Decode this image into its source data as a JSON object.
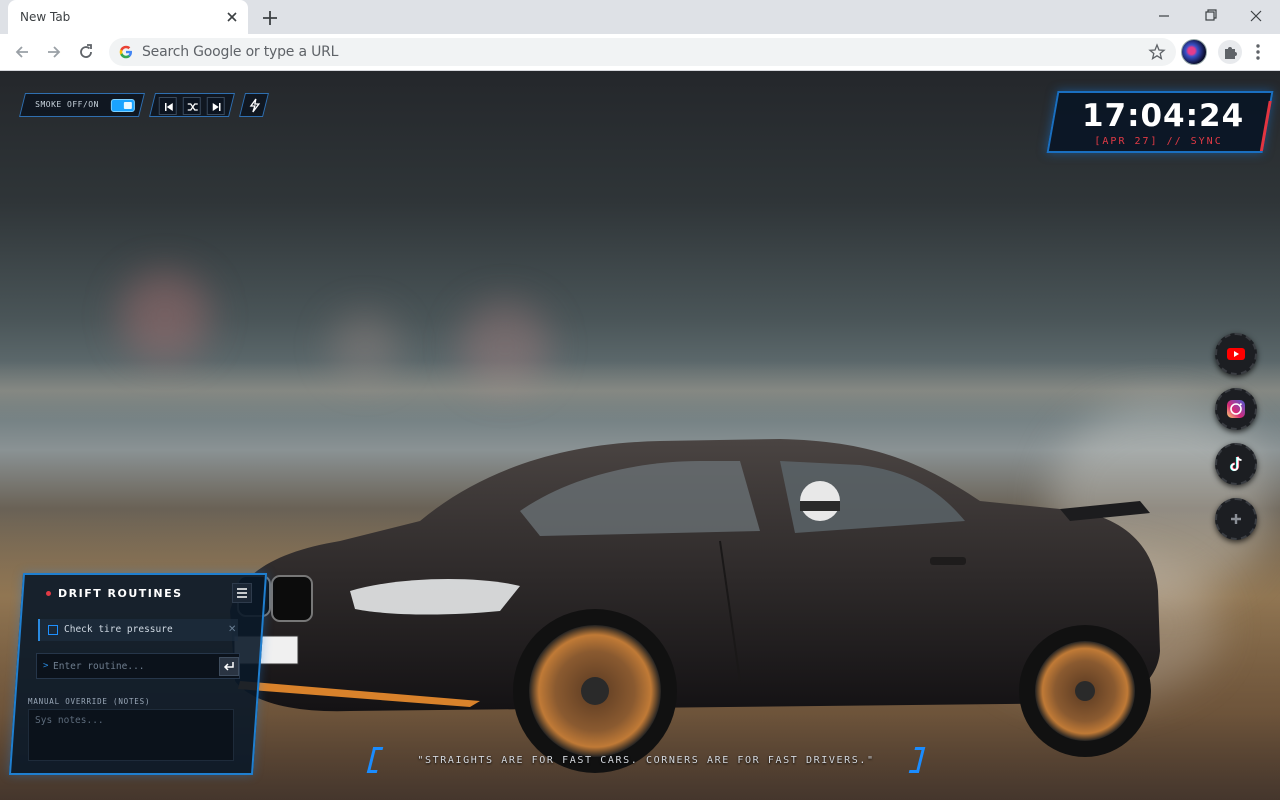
{
  "browser": {
    "tab_title": "New Tab",
    "omnibox_placeholder": "Search Google or type a URL"
  },
  "controls": {
    "smoke_toggle_label": "SMOKE OFF/ON",
    "smoke_toggle_on": true,
    "media_buttons": [
      "skip-previous-icon",
      "shuffle-icon",
      "skip-next-icon"
    ],
    "power_icon": "lightning-icon"
  },
  "clock": {
    "time": "17:04:24",
    "date_line": "[APR 27] // SYNC"
  },
  "social": [
    {
      "name": "youtube-icon",
      "color": "#ff0000"
    },
    {
      "name": "instagram-icon",
      "color": "#e1306c"
    },
    {
      "name": "tiktok-icon",
      "color": "#ffffff"
    },
    {
      "name": "add-icon",
      "color": "#8a8f96"
    }
  ],
  "drift_panel": {
    "title": "DRIFT ROUTINES",
    "tasks": [
      {
        "text": "Check tire pressure",
        "done": false
      }
    ],
    "input_prompt": ">",
    "input_placeholder": "Enter routine...",
    "notes_label": "MANUAL OVERRIDE (NOTES)",
    "notes_placeholder": "Sys notes..."
  },
  "quote": "\"STRAIGHTS ARE FOR FAST CARS. CORNERS ARE FOR FAST DRIVERS.\"",
  "colors": {
    "accent_blue": "#1a8cff",
    "accent_red": "#e23a45"
  }
}
